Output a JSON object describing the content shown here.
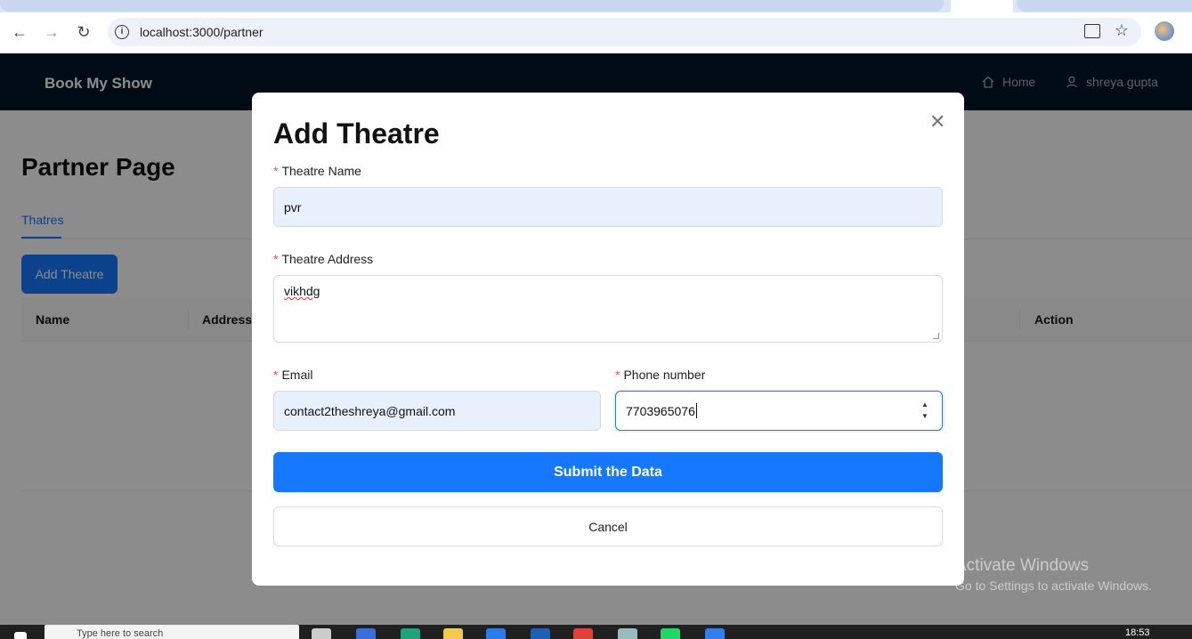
{
  "browser": {
    "url": "localhost:3000/partner"
  },
  "header": {
    "brand": "Book My Show",
    "nav": [
      {
        "label": "Home",
        "icon": "home-icon"
      },
      {
        "label": "shreya gupta",
        "icon": "user-icon"
      }
    ]
  },
  "page": {
    "title": "Partner Page",
    "tabs": [
      {
        "label": "Thatres",
        "active": true
      }
    ],
    "add_button": "Add Theatre",
    "table": {
      "columns": [
        "Name",
        "Address",
        "Action"
      ]
    }
  },
  "modal": {
    "title": "Add Theatre",
    "fields": {
      "name": {
        "label": "Theatre Name",
        "value": "pvr"
      },
      "address": {
        "label": "Theatre Address",
        "value": "vikhdg"
      },
      "email": {
        "label": "Email",
        "value": "contact2theshreya@gmail.com"
      },
      "phone": {
        "label": "Phone number",
        "value": "7703965076"
      }
    },
    "required_mark": "*",
    "submit": "Submit the Data",
    "cancel": "Cancel"
  },
  "watermark": {
    "line1": "Activate Windows",
    "line2": "Go to Settings to activate Windows."
  },
  "taskbar": {
    "search_placeholder": "Type here to search",
    "time": "18:53"
  },
  "colors": {
    "primary": "#1677ff",
    "header_bg": "#001529",
    "required": "#ff4d4f",
    "autofill_bg": "#e8f0fe"
  }
}
